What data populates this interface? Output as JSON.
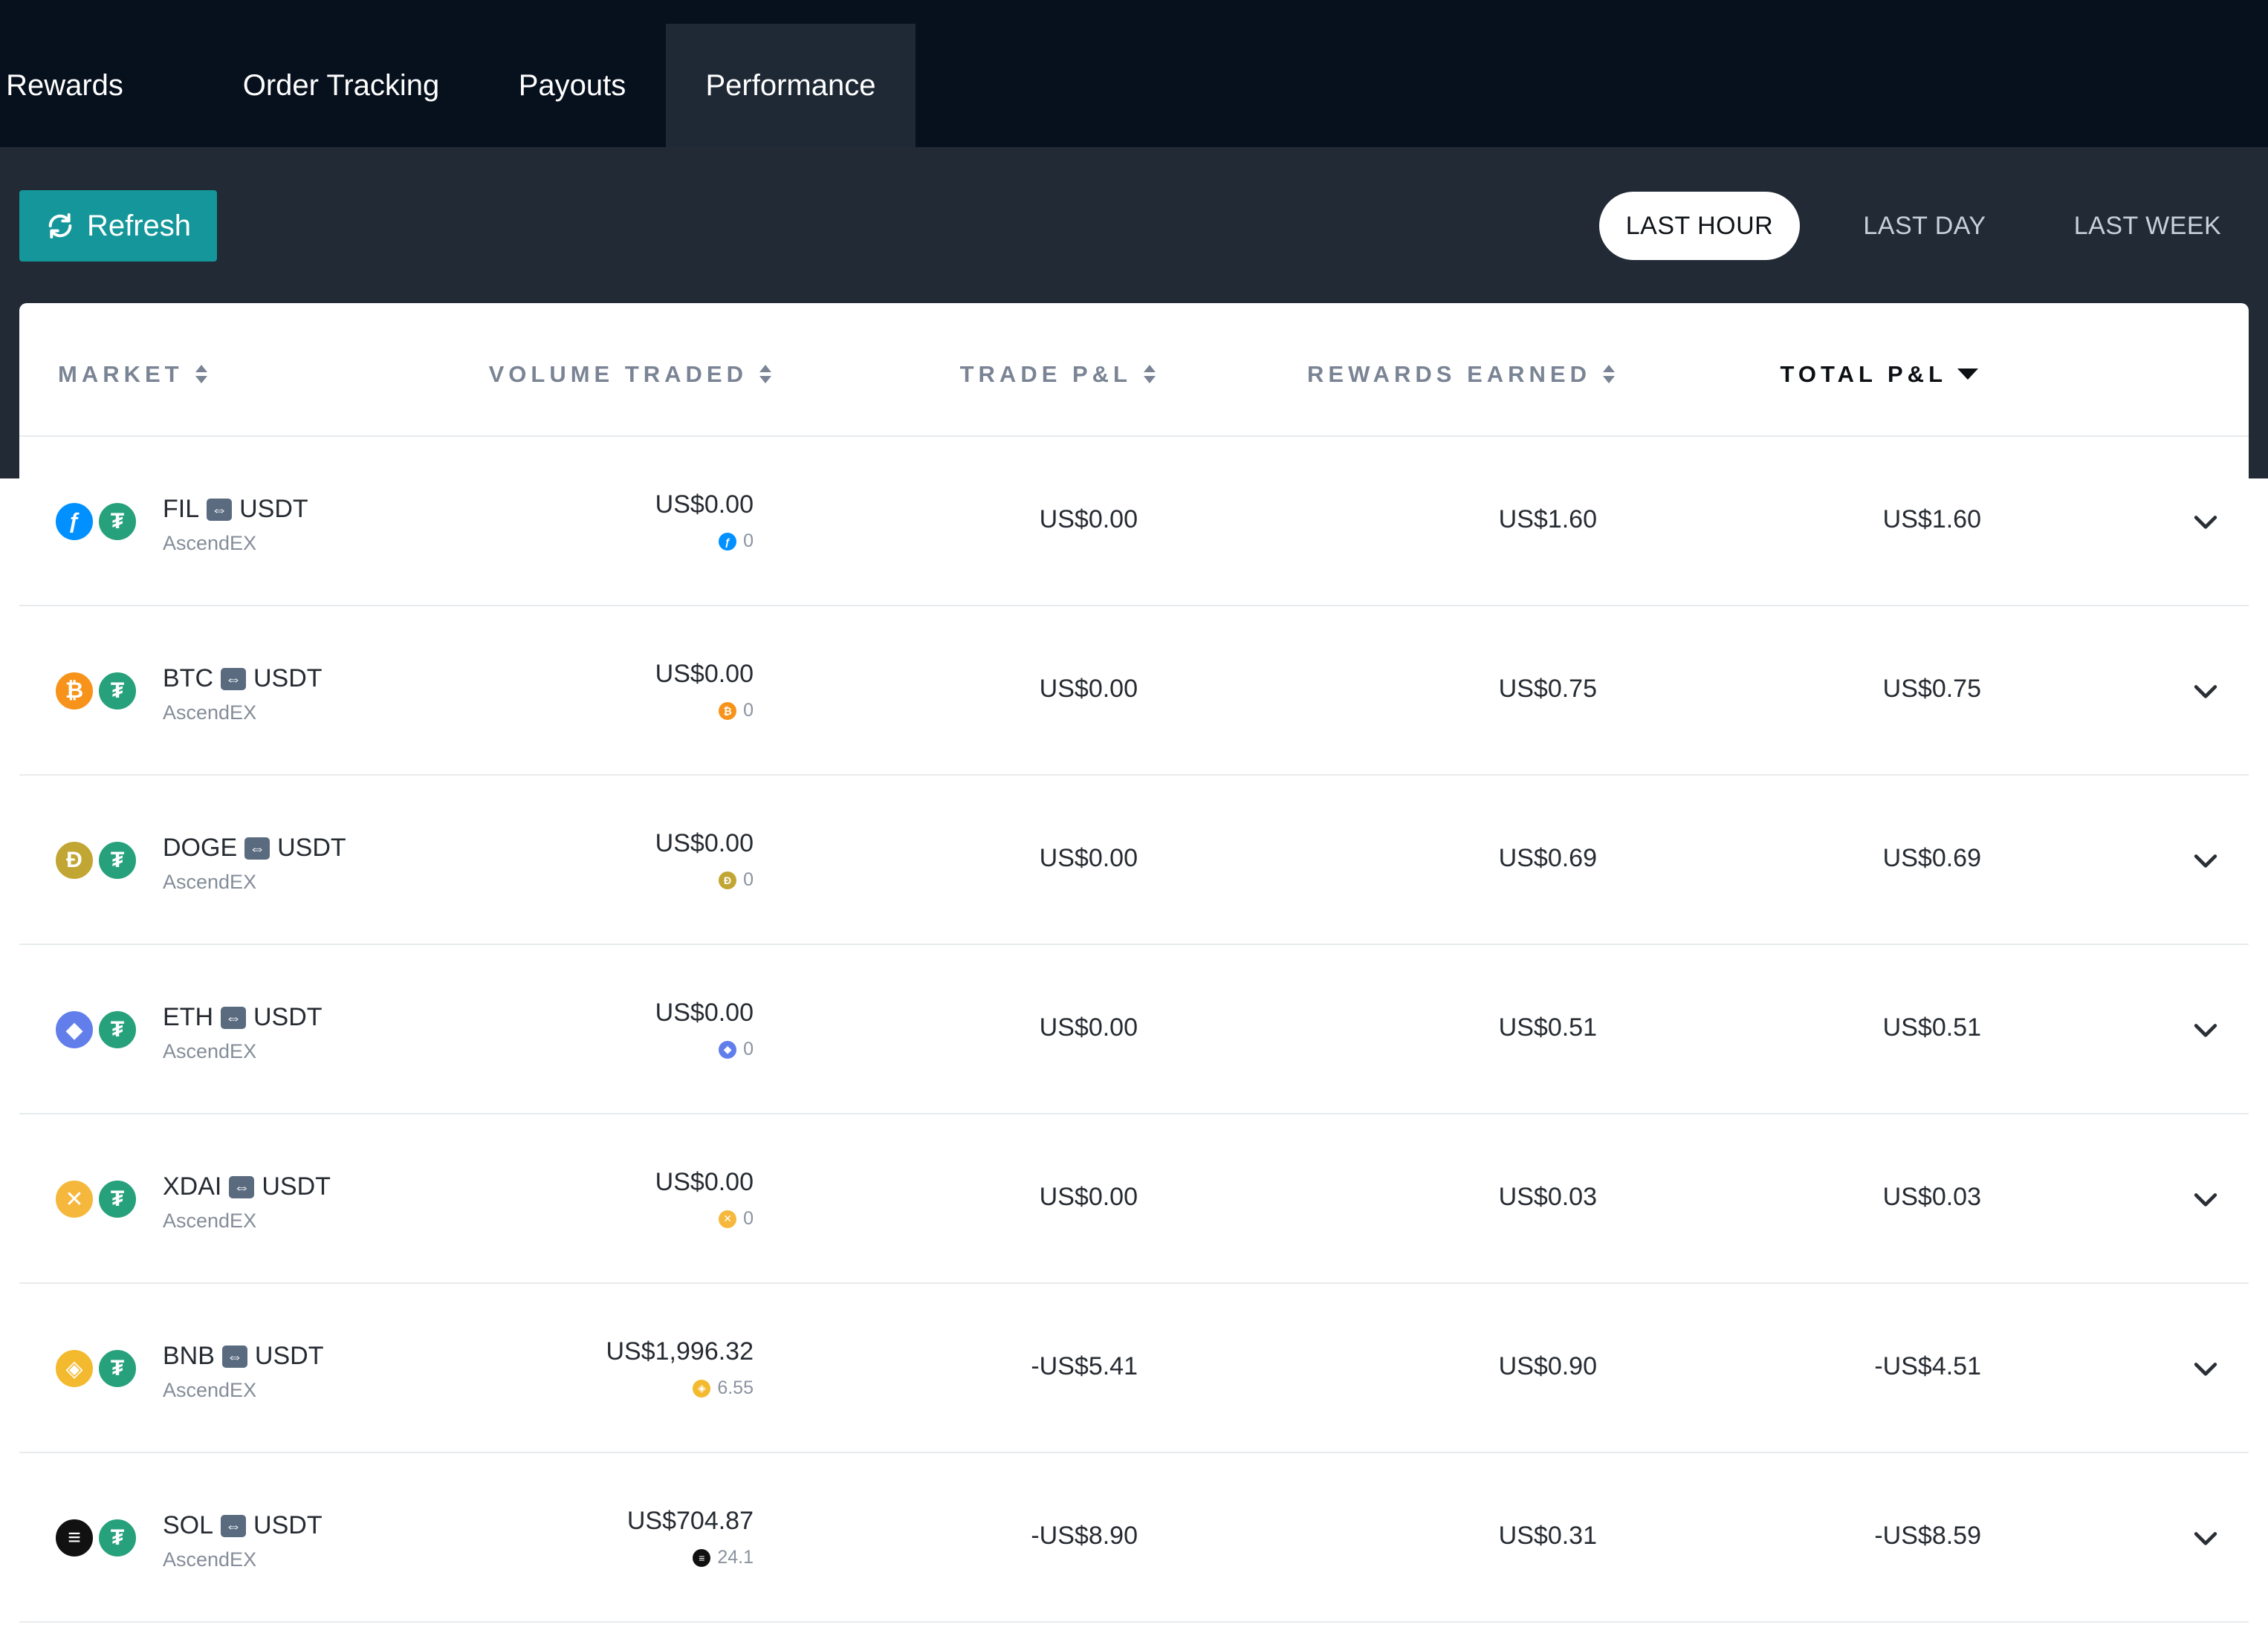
{
  "tabs": [
    {
      "label": "Rewards",
      "active": false
    },
    {
      "label": "Order Tracking",
      "active": false
    },
    {
      "label": "Payouts",
      "active": false
    },
    {
      "label": "Performance",
      "active": true
    }
  ],
  "toolbar": {
    "refresh_label": "Refresh",
    "ranges": [
      {
        "label": "LAST HOUR",
        "active": true
      },
      {
        "label": "LAST DAY",
        "active": false
      },
      {
        "label": "LAST WEEK",
        "active": false
      }
    ]
  },
  "table": {
    "headers": {
      "market": "MARKET",
      "volume": "VOLUME TRADED",
      "trade_pnl": "TRADE P&L",
      "rewards": "REWARDS EARNED",
      "total_pnl": "TOTAL P&L"
    },
    "sorted_by": "total_pnl",
    "rows": [
      {
        "base": "FIL",
        "quote": "USDT",
        "exchange": "AscendEX",
        "volume": "US$0.00",
        "volume_base": "0",
        "trade_pnl": "US$0.00",
        "rewards": "US$1.60",
        "total_pnl": "US$1.60",
        "base_color": "#0090ff",
        "base_icon": "filecoin-icon",
        "base_glyph": "ƒ"
      },
      {
        "base": "BTC",
        "quote": "USDT",
        "exchange": "AscendEX",
        "volume": "US$0.00",
        "volume_base": "0",
        "trade_pnl": "US$0.00",
        "rewards": "US$0.75",
        "total_pnl": "US$0.75",
        "base_color": "#f7931a",
        "base_icon": "bitcoin-icon",
        "base_glyph": "₿"
      },
      {
        "base": "DOGE",
        "quote": "USDT",
        "exchange": "AscendEX",
        "volume": "US$0.00",
        "volume_base": "0",
        "trade_pnl": "US$0.00",
        "rewards": "US$0.69",
        "total_pnl": "US$0.69",
        "base_color": "#c2a633",
        "base_icon": "dogecoin-icon",
        "base_glyph": "Ð"
      },
      {
        "base": "ETH",
        "quote": "USDT",
        "exchange": "AscendEX",
        "volume": "US$0.00",
        "volume_base": "0",
        "trade_pnl": "US$0.00",
        "rewards": "US$0.51",
        "total_pnl": "US$0.51",
        "base_color": "#627eea",
        "base_icon": "ethereum-icon",
        "base_glyph": "◆"
      },
      {
        "base": "XDAI",
        "quote": "USDT",
        "exchange": "AscendEX",
        "volume": "US$0.00",
        "volume_base": "0",
        "trade_pnl": "US$0.00",
        "rewards": "US$0.03",
        "total_pnl": "US$0.03",
        "base_color": "#f5b83d",
        "base_icon": "xdai-icon",
        "base_glyph": "✕"
      },
      {
        "base": "BNB",
        "quote": "USDT",
        "exchange": "AscendEX",
        "volume": "US$1,996.32",
        "volume_base": "6.55",
        "trade_pnl": "-US$5.41",
        "rewards": "US$0.90",
        "total_pnl": "-US$4.51",
        "base_color": "#f3ba2f",
        "base_icon": "bnb-icon",
        "base_glyph": "◈"
      },
      {
        "base": "SOL",
        "quote": "USDT",
        "exchange": "AscendEX",
        "volume": "US$704.87",
        "volume_base": "24.1",
        "trade_pnl": "-US$8.90",
        "rewards": "US$0.31",
        "total_pnl": "-US$8.59",
        "base_color": "#111111",
        "base_icon": "solana-icon",
        "base_glyph": "≡"
      }
    ]
  },
  "colors": {
    "nav_bg": "#07101d",
    "toolbar_bg": "#212a35",
    "accent": "#14969a",
    "usdt": "#26a17b"
  }
}
